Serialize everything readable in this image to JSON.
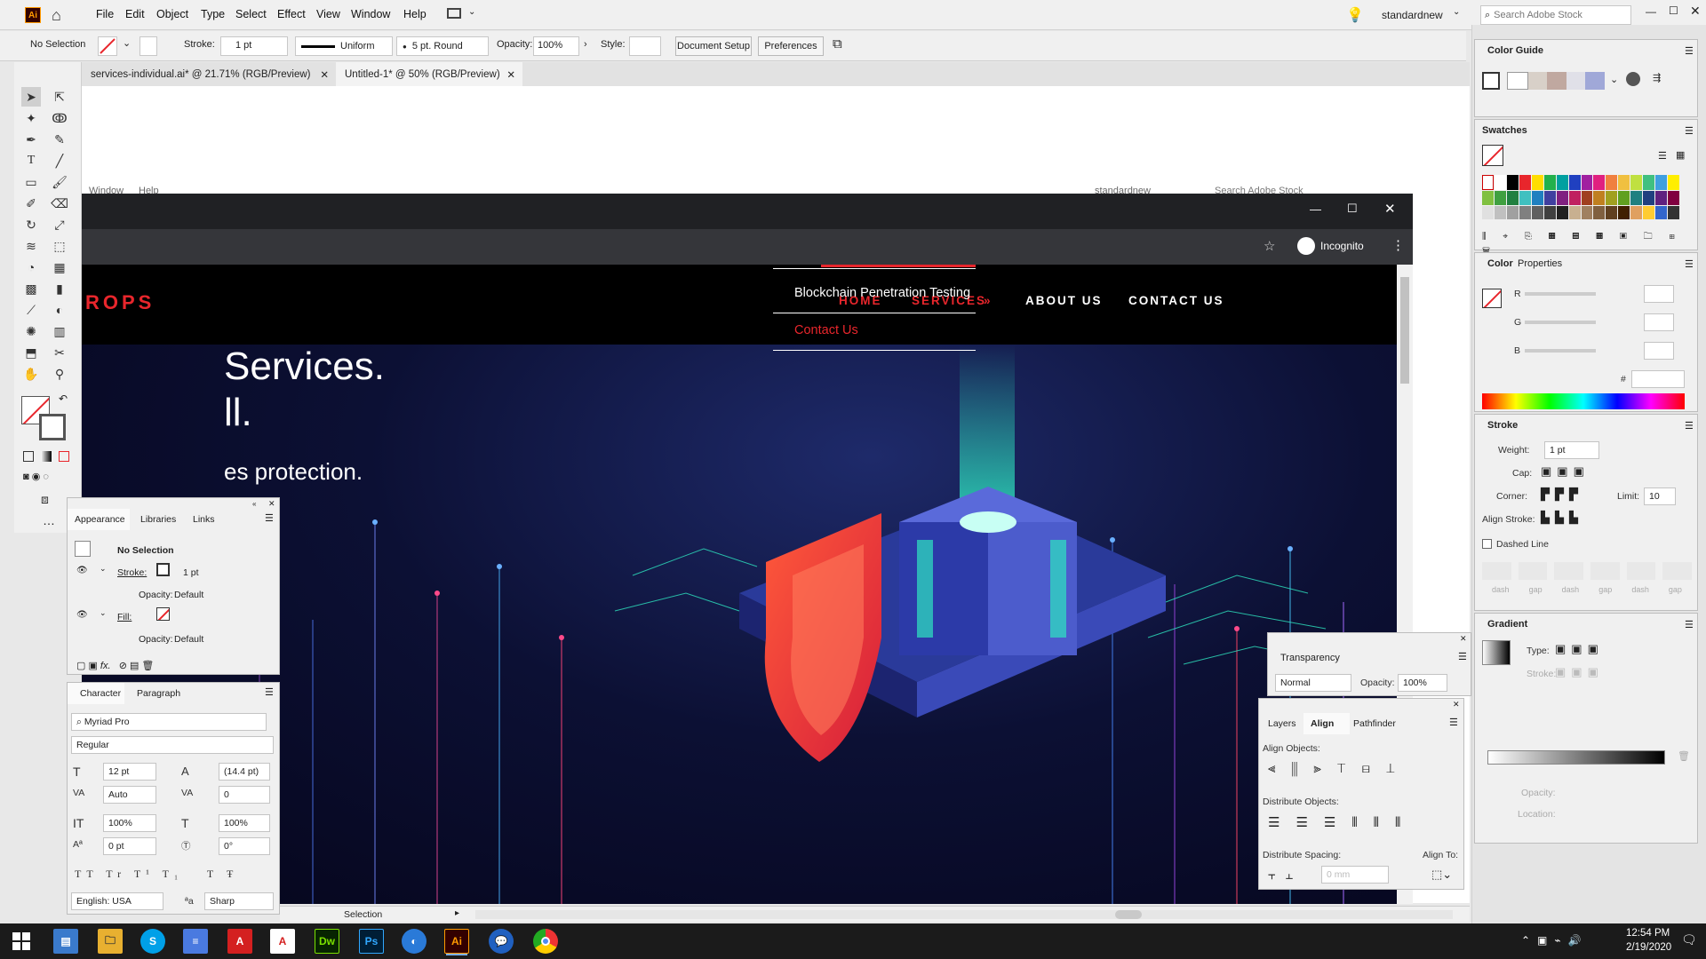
{
  "app": {
    "logo": "Ai"
  },
  "menu": [
    "File",
    "Edit",
    "Object",
    "Type",
    "Select",
    "Effect",
    "View",
    "Window",
    "Help"
  ],
  "topright": {
    "workspace": "standardnew",
    "search_placeholder": "Search Adobe Stock"
  },
  "control": {
    "selection": "No Selection",
    "stroke_label": "Stroke:",
    "stroke_value": "1 pt",
    "profile": "Uniform",
    "brush": "5 pt. Round",
    "opacity_label": "Opacity:",
    "opacity_value": "100%",
    "style_label": "Style:",
    "doc_setup": "Document Setup",
    "preferences": "Preferences"
  },
  "tabs": [
    {
      "label": "services-individual.ai* @ 21.71% (RGB/Preview)"
    },
    {
      "label": "Untitled-1* @ 50% (RGB/Preview)"
    }
  ],
  "ghost": {
    "window": "Window",
    "help": "Help",
    "workspace": "standardnew",
    "search": "Search Adobe Stock"
  },
  "browser": {
    "incognito": "Incognito"
  },
  "site": {
    "logo": "ROPS",
    "nav": [
      "HOME",
      "SERVICES",
      "ABOUT US",
      "CONTACT US"
    ],
    "dropdown": [
      "Blockchain Penetration Testing",
      "Contact Us"
    ],
    "hero_line1": "Services.",
    "hero_line2": "ll.",
    "hero_line3": "es protection."
  },
  "appearance": {
    "tabs": [
      "Appearance",
      "Libraries",
      "Links"
    ],
    "no_selection": "No Selection",
    "stroke_label": "Stroke:",
    "stroke_value": "1 pt",
    "opacity_label": "Opacity:",
    "opacity_value": "Default",
    "fill_label": "Fill:"
  },
  "character": {
    "tabs": [
      "Character",
      "Paragraph"
    ],
    "font": "Myriad Pro",
    "style": "Regular",
    "size": "12 pt",
    "leading": "(14.4 pt)",
    "kerning": "Auto",
    "tracking": "0",
    "vscale": "100%",
    "hscale": "100%",
    "baseline": "0 pt",
    "rotation": "0°",
    "language": "English: USA",
    "aa": "Sharp"
  },
  "status": {
    "tool": "Selection"
  },
  "colorguide": {
    "title": "Color Guide"
  },
  "swatches": {
    "title": "Swatches"
  },
  "color": {
    "tabs": [
      "Color",
      "Properties"
    ],
    "r": "R",
    "g": "G",
    "b": "B",
    "hex": "#"
  },
  "stroke": {
    "title": "Stroke",
    "weight_label": "Weight:",
    "weight": "1 pt",
    "cap": "Cap:",
    "corner": "Corner:",
    "limit_label": "Limit:",
    "limit": "10",
    "align": "Align Stroke:",
    "dashed": "Dashed Line",
    "dash_labels": [
      "dash",
      "gap",
      "dash",
      "gap",
      "dash",
      "gap"
    ]
  },
  "gradient": {
    "title": "Gradient",
    "type": "Type:",
    "stroke": "Stroke:",
    "opacity": "Opacity:",
    "location": "Location:"
  },
  "transparency": {
    "title": "Transparency",
    "mode": "Normal",
    "opacity_label": "Opacity:",
    "opacity": "100%"
  },
  "align": {
    "tabs": [
      "Layers",
      "Align",
      "Pathfinder"
    ],
    "align_objects": "Align Objects:",
    "distribute_objects": "Distribute Objects:",
    "distribute_spacing": "Distribute Spacing:",
    "align_to": "Align To:",
    "spacing_value": "0 mm"
  },
  "clock": {
    "time": "12:54 PM",
    "date": "2/19/2020"
  },
  "colors": {
    "accent_red": "#e8262c",
    "panel_bg": "#f0f0f0",
    "taskbar": "#1b1b1b"
  }
}
